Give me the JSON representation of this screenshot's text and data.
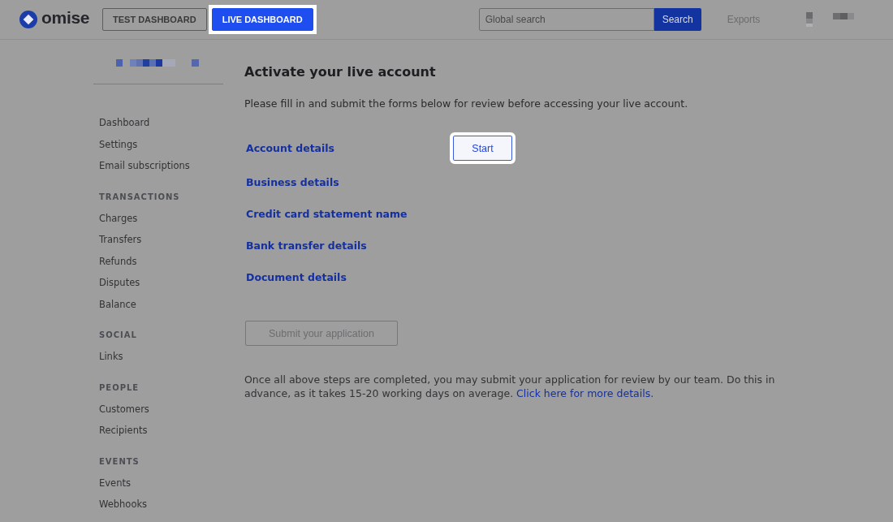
{
  "header": {
    "logo": "omise",
    "tabs": [
      {
        "label": "TEST DASHBOARD",
        "selected": false,
        "highlighted": false
      },
      {
        "label": "LIVE DASHBOARD",
        "selected": true,
        "highlighted": true
      }
    ],
    "search": {
      "placeholder": "Global search",
      "button": "Search"
    },
    "exports": {
      "label": "Exports",
      "disabled": true
    }
  },
  "sidebar": {
    "sections": [
      {
        "items": [
          "Dashboard",
          "Settings",
          "Email subscriptions"
        ]
      },
      {
        "heading": "TRANSACTIONS",
        "items": [
          "Charges",
          "Transfers",
          "Refunds",
          "Disputes",
          "Balance"
        ]
      },
      {
        "heading": "SOCIAL",
        "items": [
          "Links"
        ]
      },
      {
        "heading": "PEOPLE",
        "items": [
          "Customers",
          "Recipients"
        ]
      },
      {
        "heading": "EVENTS",
        "items": [
          "Events",
          "Webhooks"
        ]
      }
    ]
  },
  "main": {
    "title": "Activate your live account",
    "intro": "Please fill in and submit the forms below for review before accessing your live account.",
    "steps": [
      {
        "label": "Account details",
        "action": {
          "label": "Start",
          "highlighted": true
        }
      },
      {
        "label": "Business details"
      },
      {
        "label": "Credit card statement name"
      },
      {
        "label": "Bank transfer details"
      },
      {
        "label": "Document details"
      }
    ],
    "submit": {
      "label": "Submit your application",
      "disabled": true
    },
    "note": "Once all above steps are completed, you may submit your application for review by our team. Do this in advance, as it takes 15-20 working days on average.",
    "note_link": "Click here for more details."
  }
}
